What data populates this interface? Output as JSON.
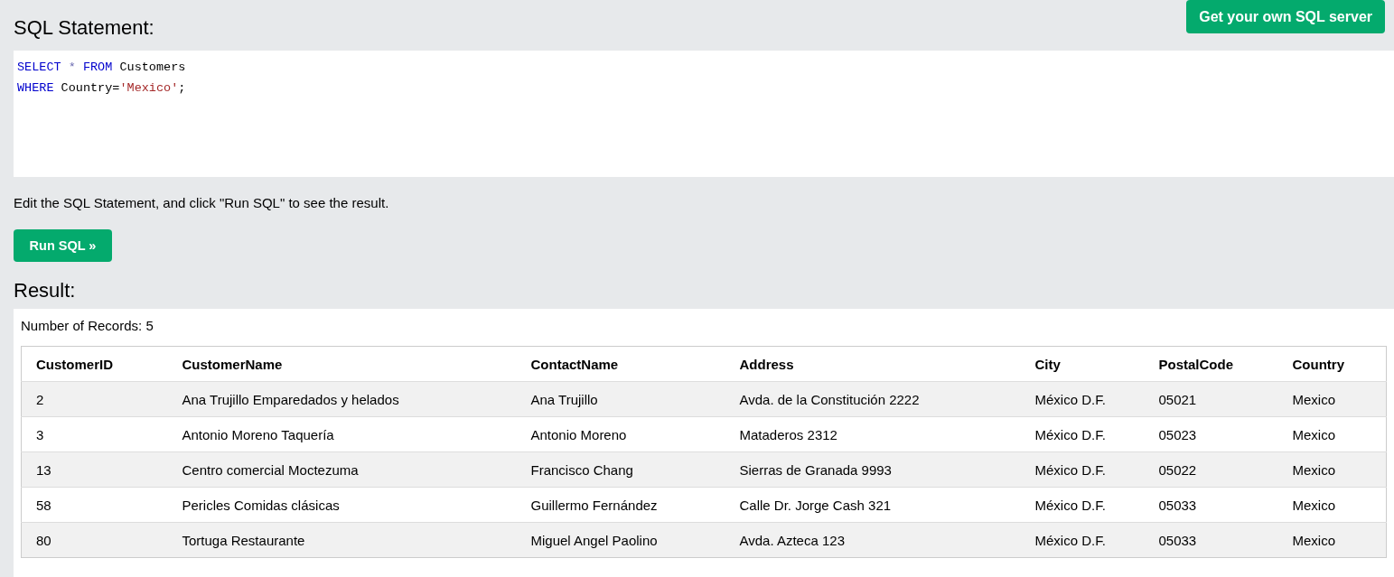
{
  "header": {
    "title": "SQL Statement:",
    "server_button": "Get your own SQL server"
  },
  "editor": {
    "lines": [
      [
        {
          "kind": "keyword",
          "text": "SELECT"
        },
        {
          "kind": "operator",
          "text": " * "
        },
        {
          "kind": "keyword",
          "text": "FROM"
        },
        {
          "kind": "plain",
          "text": " Customers"
        }
      ],
      [
        {
          "kind": "keyword",
          "text": "WHERE"
        },
        {
          "kind": "plain",
          "text": " Country="
        },
        {
          "kind": "string",
          "text": "'Mexico'"
        },
        {
          "kind": "plain",
          "text": ";"
        }
      ]
    ]
  },
  "instruction": "Edit the SQL Statement, and click \"Run SQL\" to see the result.",
  "run_button": "Run SQL »",
  "result": {
    "title": "Result:",
    "record_count": "Number of Records: 5",
    "table": {
      "columns": [
        "CustomerID",
        "CustomerName",
        "ContactName",
        "Address",
        "City",
        "PostalCode",
        "Country"
      ],
      "rows": [
        [
          "2",
          "Ana Trujillo Emparedados y helados",
          "Ana Trujillo",
          "Avda. de la Constitución 2222",
          "México D.F.",
          "05021",
          "Mexico"
        ],
        [
          "3",
          "Antonio Moreno Taquería",
          "Antonio Moreno",
          "Mataderos 2312",
          "México D.F.",
          "05023",
          "Mexico"
        ],
        [
          "13",
          "Centro comercial Moctezuma",
          "Francisco Chang",
          "Sierras de Granada 9993",
          "México D.F.",
          "05022",
          "Mexico"
        ],
        [
          "58",
          "Pericles Comidas clásicas",
          "Guillermo Fernández",
          "Calle Dr. Jorge Cash 321",
          "México D.F.",
          "05033",
          "Mexico"
        ],
        [
          "80",
          "Tortuga Restaurante",
          "Miguel Angel Paolino",
          "Avda. Azteca 123",
          "México D.F.",
          "05033",
          "Mexico"
        ]
      ]
    }
  }
}
